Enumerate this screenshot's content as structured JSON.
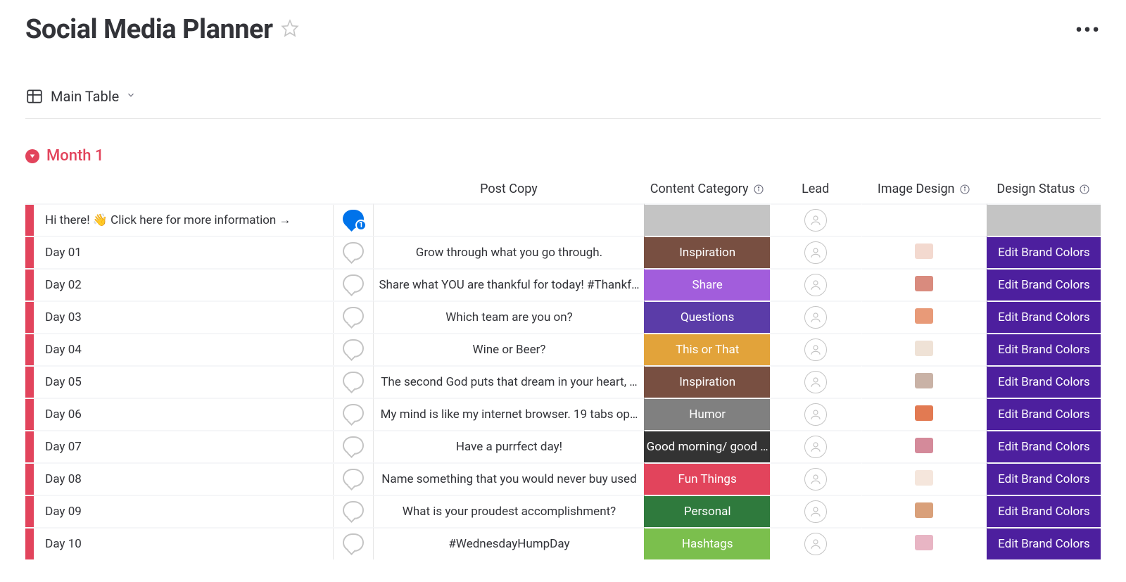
{
  "header": {
    "title": "Social Media Planner"
  },
  "view": {
    "name": "Main Table"
  },
  "group": {
    "name": "Month 1"
  },
  "columns": {
    "post_copy": "Post Copy",
    "category": "Content Category",
    "lead": "Lead",
    "image": "Image Design",
    "status": "Design Status"
  },
  "categories": {
    "Inspiration": "#784f41",
    "Share": "#a25ddc",
    "Questions": "#5b3ca8",
    "This or That": "#e2a33a",
    "Humor": "#808080",
    "Good morning/ good …": "#333333",
    "Fun Things": "#e2445c",
    "Personal": "#2f7a3d",
    "Hashtags": "#7bbf4d"
  },
  "status_color": "#4d1f9e",
  "rows": [
    {
      "name": "Hi there! 👋 Click here for more information →",
      "comment_filled": true,
      "post": "",
      "cat": "",
      "cat_gray": true,
      "thumb": "",
      "status": "",
      "status_gray": true
    },
    {
      "name": "Day 01",
      "post": "Grow through what you go through.",
      "cat": "Inspiration",
      "thumb": "#f3d9cf",
      "status": "Edit Brand Colors"
    },
    {
      "name": "Day 02",
      "post": "Share what YOU are thankful for today! #Thankf…",
      "cat": "Share",
      "thumb": "#d98b7e",
      "status": "Edit Brand Colors"
    },
    {
      "name": "Day 03",
      "post": "Which team are you on?",
      "cat": "Questions",
      "thumb": "#e89a78",
      "status": "Edit Brand Colors"
    },
    {
      "name": "Day 04",
      "post": "Wine or Beer?",
      "cat": "This or That",
      "thumb": "#efe2d6",
      "status": "Edit Brand Colors"
    },
    {
      "name": "Day 05",
      "post": "The second God puts that dream in your heart, …",
      "cat": "Inspiration",
      "thumb": "#c9b2a6",
      "status": "Edit Brand Colors"
    },
    {
      "name": "Day 06",
      "post": "My mind is like my internet browser. 19 tabs op…",
      "cat": "Humor",
      "thumb": "#e27a52",
      "status": "Edit Brand Colors"
    },
    {
      "name": "Day 07",
      "post": "Have a purrfect day!",
      "cat": "Good morning/ good …",
      "thumb": "#d48a9a",
      "status": "Edit Brand Colors"
    },
    {
      "name": "Day 08",
      "post": "Name something that you would never buy used",
      "cat": "Fun Things",
      "thumb": "#f5e6dc",
      "status": "Edit Brand Colors"
    },
    {
      "name": "Day 09",
      "post": "What is your proudest accomplishment?",
      "cat": "Personal",
      "thumb": "#d9a07a",
      "status": "Edit Brand Colors"
    },
    {
      "name": "Day 10",
      "post": "#WednesdayHumpDay",
      "cat": "Hashtags",
      "thumb": "#e8b5c4",
      "status": "Edit Brand Colors"
    }
  ]
}
